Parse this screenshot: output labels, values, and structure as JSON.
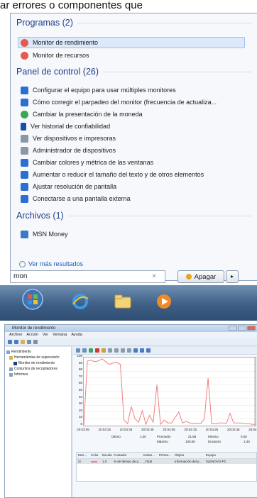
{
  "caption": "ar errores o componentes que",
  "startmenu": {
    "programs": {
      "header": "Programas (2)",
      "items": [
        "Monitor de rendimiento",
        "Monitor de recursos"
      ]
    },
    "control_panel": {
      "header": "Panel de control (26)",
      "items": [
        "Configurar el equipo para usar múltiples monitores",
        "Cómo corregir el parpadeo del monitor (frecuencia de actualiza...",
        "Cambiar la presentación de la moneda",
        "Ver historial de confiabilidad",
        "Ver dispositivos e impresoras",
        "Administrador de dispositivos",
        "Cambiar colores y métrica de las ventanas",
        "Aumentar o reducir el tamaño del texto y de otros elementos",
        "Ajustar resolución de pantalla",
        "Conectarse a una pantalla externa"
      ]
    },
    "files": {
      "header": "Archivos (1)",
      "items": [
        "MSN Money"
      ]
    },
    "more_results": "Ver más resultados",
    "search_value": "mon",
    "search_clear": "×",
    "shutdown_label": "Apagar",
    "shutdown_arrow": "▸"
  },
  "perfmon": {
    "title": "Monitor de rendimiento",
    "menu": [
      "Archivo",
      "Acción",
      "Ver",
      "Ventana",
      "Ayuda"
    ],
    "tree": [
      "Rendimiento",
      "Herramientas de supervisión",
      "Monitor de rendimiento",
      "Conjuntos de recopiladores",
      "Informes"
    ],
    "y_ticks": [
      "100",
      "90",
      "80",
      "70",
      "60",
      "50",
      "40",
      "30",
      "20",
      "10",
      "0"
    ],
    "x_ticks": [
      "20:03:05",
      "20:03:25",
      "20:03:35",
      "20:03:45",
      "20:04:05",
      "20:04:15",
      "20:04:25",
      "20:04:35",
      "20:04:50"
    ],
    "stats": {
      "last_label": "Último",
      "last_value": "1,00",
      "avg_label": "Promedio",
      "avg_value": "21,85",
      "min_label": "Mínimo",
      "min_value": "0,00",
      "max_label": "Máximo",
      "max_value": "100,00",
      "dur_label": "Duración",
      "dur_value": "1:40"
    },
    "counter_headers": [
      "Mos...",
      "Color",
      "Escala",
      "Contador",
      "Instan...",
      "Primar...",
      "Objeto",
      "Equipo"
    ],
    "counter_row": [
      "",
      "",
      "1,0",
      "% de tiempo de p...",
      "_Total",
      "",
      "Información del p...",
      "\\\\LENOVO-PC"
    ]
  },
  "colors": {
    "section_header": "#1e3f8a",
    "link": "#1e5bb8",
    "graph_line": "#f08080",
    "taskbar": "#3e5f86"
  },
  "chart_data": {
    "type": "line",
    "title": "",
    "ylim": [
      0,
      100
    ],
    "x": [
      "20:03:05",
      "20:03:25",
      "20:03:35",
      "20:03:45",
      "20:04:05",
      "20:04:15",
      "20:04:25",
      "20:04:35",
      "20:04:50"
    ],
    "series": [
      {
        "values": [
          0,
          95,
          96,
          94,
          95,
          98,
          94,
          90,
          92,
          93,
          90,
          8,
          3,
          28,
          10,
          5,
          22,
          2,
          15,
          5,
          60,
          2,
          8,
          4,
          4,
          12,
          20,
          4,
          6,
          4,
          3,
          4,
          3,
          10,
          70,
          3,
          3,
          4,
          4,
          3,
          18,
          4,
          4,
          4,
          3,
          3,
          2,
          2
        ]
      }
    ]
  }
}
